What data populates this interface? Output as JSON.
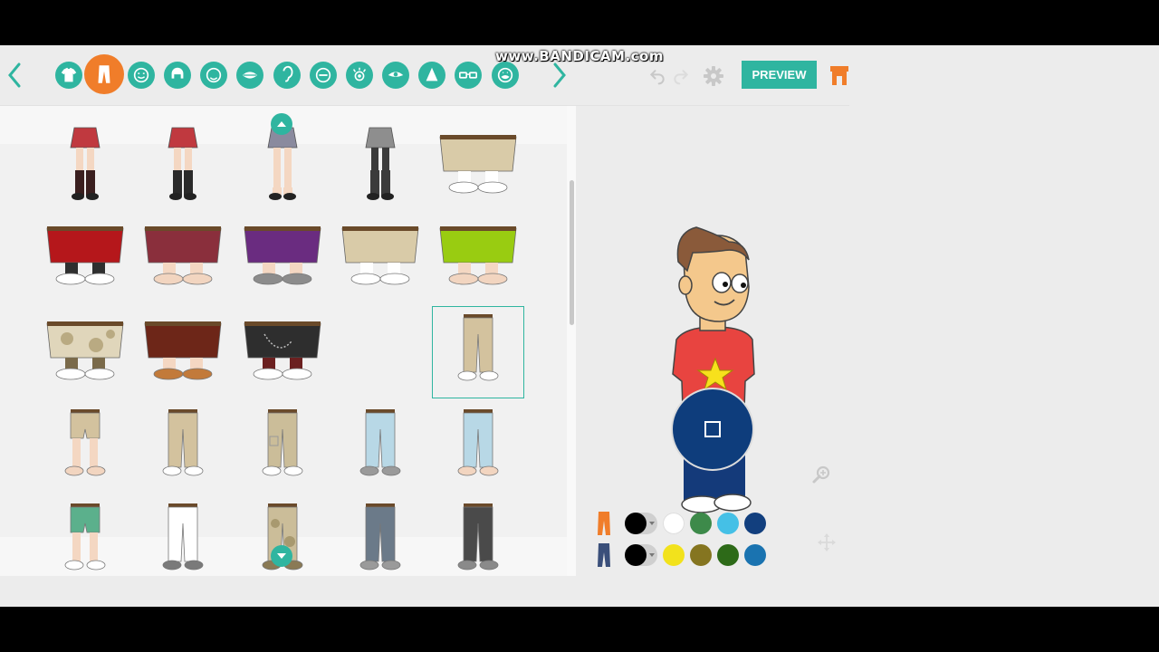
{
  "watermark": "www.BANDICAM.com",
  "toolbar": {
    "prev_icon": "chevron-left-icon",
    "next_icon": "chevron-right-icon",
    "categories": [
      {
        "icon": "shirt-icon",
        "active": false
      },
      {
        "icon": "pants-icon",
        "active": true
      },
      {
        "icon": "face-icon",
        "active": false
      },
      {
        "icon": "hair-icon",
        "active": false
      },
      {
        "icon": "face-shape-icon",
        "active": false
      },
      {
        "icon": "mouth-icon",
        "active": false
      },
      {
        "icon": "ear-icon",
        "active": false
      },
      {
        "icon": "eyebrow-icon",
        "active": false
      },
      {
        "icon": "eye-icon",
        "active": false
      },
      {
        "icon": "eye-shape-icon",
        "active": false
      },
      {
        "icon": "nose-icon",
        "active": false
      },
      {
        "icon": "glasses-icon",
        "active": false
      },
      {
        "icon": "facial-hair-icon",
        "active": false
      }
    ],
    "undo_icon": "undo-icon",
    "redo_icon": "redo-icon",
    "settings_icon": "gear-icon",
    "preview_label": "PREVIEW",
    "store_icon": "store-icon"
  },
  "panel": {
    "scroll_up_icon": "chevron-up-icon",
    "scroll_down_icon": "chevron-down-icon",
    "selected_item": "item-r3-c5",
    "items": [
      {
        "kind": "skirt-plaid",
        "colors": [
          "#c0393f",
          "#3a1f1f"
        ]
      },
      {
        "kind": "skirt-boots",
        "colors": [
          "#c0393f",
          "#2a2a2a"
        ]
      },
      {
        "kind": "skirt-lace",
        "colors": [
          "#8a8a9e",
          "#f4d7c2"
        ]
      },
      {
        "kind": "skirt-fishnet",
        "colors": [
          "#8e8e8e",
          "#3b3b3b"
        ]
      },
      {
        "kind": "shorts-wide",
        "colors": [
          "#d9cba8",
          "#ffffff"
        ]
      },
      {
        "kind": "shorts-wide",
        "colors": [
          "#b5171b",
          "#2f2f2f"
        ]
      },
      {
        "kind": "skirt-wide",
        "colors": [
          "#8a2f3c",
          "#f2d5c0"
        ]
      },
      {
        "kind": "skirt-wide",
        "colors": [
          "#6a2c80",
          "#8c8c8c"
        ]
      },
      {
        "kind": "shorts-wide",
        "colors": [
          "#d9cba8",
          "#ffffff"
        ]
      },
      {
        "kind": "skirt-wide",
        "colors": [
          "#99cc11",
          "#f2d5c0"
        ]
      },
      {
        "kind": "shorts-camo",
        "colors": [
          "#e0d6bb",
          "#7a6a4a"
        ]
      },
      {
        "kind": "skirt-wide",
        "colors": [
          "#6d2618",
          "#c27a3a"
        ]
      },
      {
        "kind": "shorts-chain",
        "colors": [
          "#2e2e2e",
          "#6b2020"
        ]
      },
      {
        "kind": "empty",
        "colors": []
      },
      {
        "kind": "pants-slim",
        "colors": [
          "#d3c29e",
          "#ffffff"
        ]
      },
      {
        "kind": "shorts-slim",
        "colors": [
          "#d3c29e",
          "#f2d5c0"
        ]
      },
      {
        "kind": "pants-slim",
        "colors": [
          "#d3c29e",
          "#ffffff"
        ]
      },
      {
        "kind": "pants-cargo",
        "colors": [
          "#cbbd99",
          "#ffffff"
        ]
      },
      {
        "kind": "pants-slim",
        "colors": [
          "#b8d8e6",
          "#9a9a9a"
        ]
      },
      {
        "kind": "pants-slim",
        "colors": [
          "#b8d8e6",
          "#f2d5c0"
        ]
      },
      {
        "kind": "shorts-slim",
        "colors": [
          "#5bb08c",
          "#ffffff"
        ]
      },
      {
        "kind": "pants-slim",
        "colors": [
          "#ffffff",
          "#7a7a7a"
        ]
      },
      {
        "kind": "pants-camo",
        "colors": [
          "#cbbd99",
          "#8a7a55"
        ]
      },
      {
        "kind": "pants-slim",
        "colors": [
          "#6b7a89",
          "#9a9a9a"
        ]
      },
      {
        "kind": "pants-slim",
        "colors": [
          "#4a4a4a",
          "#8a8a8a"
        ]
      }
    ]
  },
  "stage": {
    "character": {
      "skin": "#f4c88c",
      "hair": "#8a5a3a",
      "shirt": "#e84440",
      "star": "#f7e11c",
      "pants": "#143a7a",
      "shoes": "#ffffff"
    },
    "record_icon": "stop-icon",
    "zoom_icon": "zoom-in-icon",
    "move_icon": "move-icon"
  },
  "color_rows": [
    {
      "part_icon": "pants-orange-icon",
      "part_color": "#f07d2a",
      "current": "#000000",
      "swatches": [
        "#ffffff",
        "#3d8a4a",
        "#45c0e6",
        "#123f7e"
      ]
    },
    {
      "part_icon": "pants-blue-icon",
      "part_color": "#3a4f7a",
      "current": "#000000",
      "swatches": [
        "#f2e21c",
        "#857520",
        "#2d6a18",
        "#1a73b0"
      ]
    }
  ],
  "accent": "#2fb5a0",
  "active_accent": "#f07d2a"
}
